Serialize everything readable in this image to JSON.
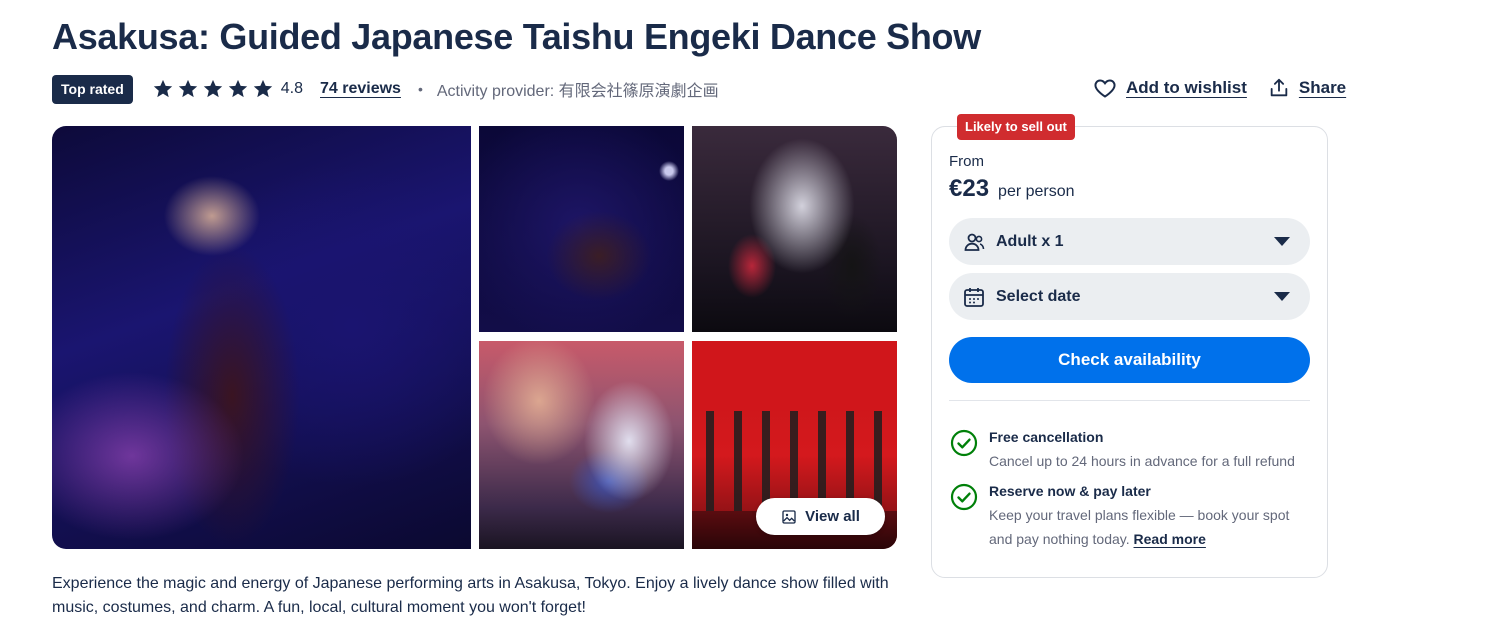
{
  "title": "Asakusa: Guided Japanese Taishu Engeki Dance Show",
  "meta": {
    "badge": "Top rated",
    "stars": 5,
    "rating": "4.8",
    "reviews": "74 reviews",
    "separator": "•",
    "provider": "Activity provider: 有限会社篠原演劇企画"
  },
  "actions": {
    "wishlist": "Add to wishlist",
    "share": "Share"
  },
  "gallery": {
    "view_all": "View all"
  },
  "description": "Experience the magic and energy of Japanese performing arts in Asakusa, Tokyo. Enjoy a lively dance show filled with music, costumes, and charm. A fun, local, cultural moment you won't forget!",
  "booking": {
    "urgency_badge": "Likely to sell out",
    "from_label": "From",
    "price": "€23",
    "per": "per person",
    "participants": "Adult x 1",
    "date": "Select date",
    "cta": "Check availability",
    "features": [
      {
        "title": "Free cancellation",
        "desc": "Cancel up to 24 hours in advance for a full refund"
      },
      {
        "title": "Reserve now & pay later",
        "desc": "Keep your travel plans flexible — book your spot and pay nothing today.",
        "link": "Read more"
      }
    ]
  },
  "colors": {
    "navy": "#1a2b49",
    "primary": "#0071eb",
    "urgency": "#d02c2f",
    "success": "#008009"
  }
}
